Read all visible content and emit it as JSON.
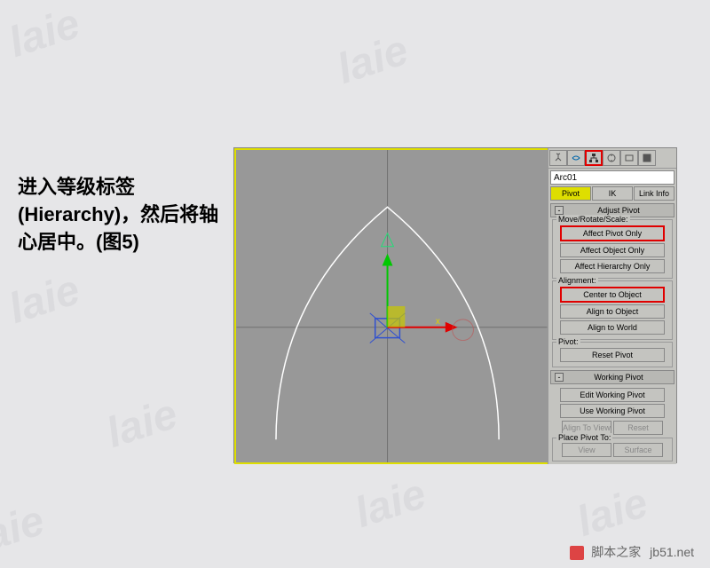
{
  "watermarks": [
    "laie",
    "laie",
    "laie",
    "laie",
    "laie",
    "laie",
    "laie"
  ],
  "instruction": "进入等级标签 (Hierarchy)，然后将轴心居中。(图5)",
  "object_name": "Arc01",
  "subtabs": {
    "pivot": "Pivot",
    "ik": "IK",
    "linkinfo": "Link Info"
  },
  "roll_adjust": "Adjust Pivot",
  "group_mrs": "Move/Rotate/Scale:",
  "btn_affect_pivot": "Affect Pivot Only",
  "btn_affect_object": "Affect Object Only",
  "btn_affect_hierarchy": "Affect Hierarchy Only",
  "group_alignment": "Alignment:",
  "btn_center": "Center to Object",
  "btn_align_object": "Align to Object",
  "btn_align_world": "Align to World",
  "group_pivot": "Pivot:",
  "btn_reset": "Reset Pivot",
  "roll_working": "Working Pivot",
  "btn_edit_working": "Edit Working Pivot",
  "btn_use_working": "Use Working Pivot",
  "btn_align_view": "Align To View",
  "btn_reset2": "Reset",
  "group_place": "Place Pivot To:",
  "btn_view": "View",
  "btn_surface": "Surface",
  "footer_text": "脚本之家",
  "footer_url": "jb51.net"
}
